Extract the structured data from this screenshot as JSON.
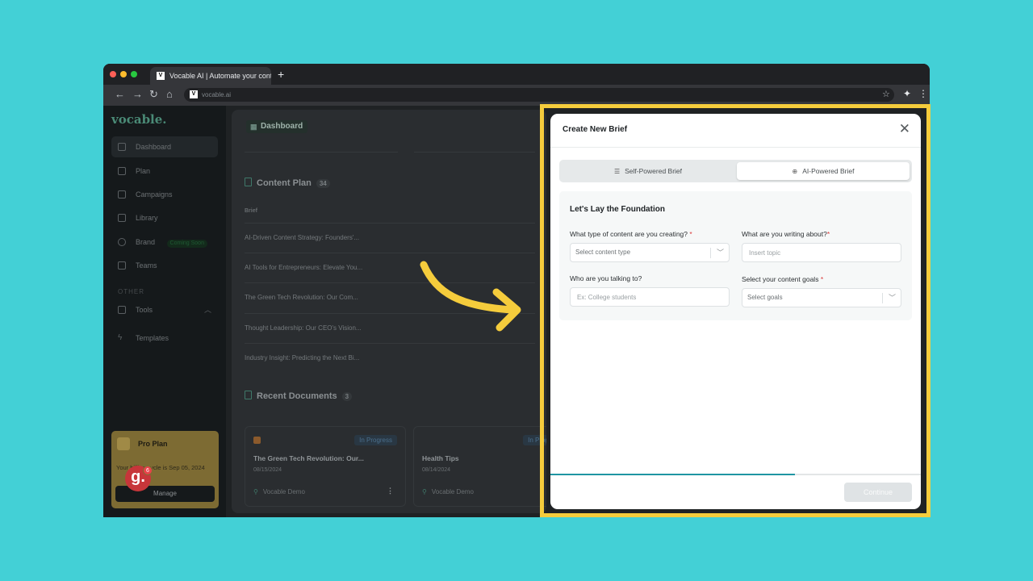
{
  "browser": {
    "tab_title": "Vocable AI | Automate your conten",
    "new_tab": "+",
    "address": "vocable.ai",
    "favicon": "V"
  },
  "sidebar": {
    "logo": "vocable.",
    "items": [
      {
        "label": "Dashboard",
        "icon": "grid-icon"
      },
      {
        "label": "Plan",
        "icon": "calendar-icon"
      },
      {
        "label": "Campaigns",
        "icon": "layers-icon"
      },
      {
        "label": "Library",
        "icon": "folder-icon"
      },
      {
        "label": "Brand",
        "icon": "smiley-icon",
        "badge": "Coming Soon"
      },
      {
        "label": "Teams",
        "icon": "users-icon"
      }
    ],
    "section_other": "OTHER",
    "other_items": [
      {
        "label": "Tools",
        "icon": "briefcase-icon"
      },
      {
        "label": "Templates",
        "icon": "bolt-icon"
      }
    ],
    "pro_plan": {
      "title": "Pro Plan",
      "text": "Your billing cycle is Sep 05, 2024",
      "manage": "Manage"
    },
    "g_badge": {
      "letter": "g.",
      "count": "6"
    }
  },
  "main": {
    "dashboard_label": "Dashboard",
    "content_plan": {
      "title": "Content Plan",
      "count": "34",
      "column": "Brief",
      "rows": [
        "AI-Driven Content Strategy: Founders'...",
        "AI Tools for Entrepreneurs: Elevate You...",
        "The Green Tech Revolution: Our Com...",
        "Thought Leadership: Our CEO's Vision...",
        "Industry Insight: Predicting the Next Bi..."
      ]
    },
    "recent_documents": {
      "title": "Recent Documents",
      "count": "3",
      "cards": [
        {
          "status": "In Progress",
          "title": "The Green Tech Revolution: Our...",
          "date": "08/15/2024",
          "user": "Vocable Demo"
        },
        {
          "status": "In Progress",
          "title": "Health Tips",
          "date": "08/14/2024",
          "user": "Vocable Demo"
        }
      ]
    }
  },
  "modal": {
    "title": "Create New Brief",
    "tabs": [
      {
        "label": "Self-Powered Brief",
        "icon": "list-icon"
      },
      {
        "label": "AI-Powered Brief",
        "icon": "globe-icon"
      }
    ],
    "section_title": "Let's Lay the Foundation",
    "fields": {
      "content_type": {
        "label": "What type of content are you creating?",
        "required": "*",
        "placeholder": "Select content type"
      },
      "topic": {
        "label": "What are you writing about?",
        "required": "*",
        "placeholder": "Insert topic"
      },
      "audience": {
        "label": "Who are you talking to?",
        "placeholder": "Ex: College students"
      },
      "goals": {
        "label": "Select your content goals",
        "required": "*",
        "placeholder": "Select goals"
      }
    },
    "progress": 0.66,
    "continue_label": "Continue"
  },
  "colors": {
    "background": "#43d0d6",
    "highlight_frame": "#f5cc3c",
    "arrow": "#f5cc3c",
    "progress": "#1f95a3"
  }
}
